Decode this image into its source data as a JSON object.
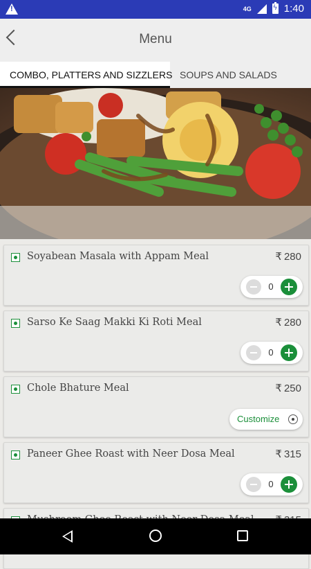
{
  "status_bar": {
    "network": "4G",
    "time": "1:40"
  },
  "header": {
    "title": "Menu"
  },
  "tabs": [
    {
      "label": "COMBO, PLATTERS AND SIZZLERS",
      "active": true
    },
    {
      "label": "SOUPS AND SALADS",
      "active": false
    }
  ],
  "currency_symbol": "₹",
  "items": [
    {
      "name": "Soyabean Masala with Appam Meal",
      "price": "280",
      "quantity": "0"
    },
    {
      "name": "Sarso Ke Saag Makki Ki Roti Meal",
      "price": "280",
      "quantity": "0"
    },
    {
      "name": "Chole Bhature Meal",
      "price": "250",
      "customize_label": "Customize"
    },
    {
      "name": "Paneer Ghee Roast with Neer Dosa Meal",
      "price": "315",
      "quantity": "0"
    },
    {
      "name": "Mushroom Ghee Roast with Neer Dosa Meal",
      "price": "315"
    }
  ],
  "colors": {
    "status_bar": "#2b3bb6",
    "veg_green": "#1b8f3a",
    "header_bg": "#eeeeee"
  }
}
